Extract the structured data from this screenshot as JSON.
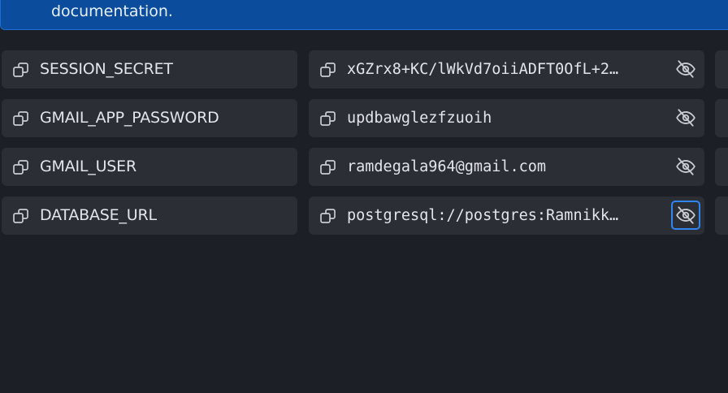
{
  "banner": {
    "text": "documentation."
  },
  "secrets": [
    {
      "key": "SESSION_SECRET",
      "value": "xGZrx8+KC/lWkVd7oiiADFT0OfL+2…",
      "eye_focused": false
    },
    {
      "key": "GMAIL_APP_PASSWORD",
      "value": "updbawglezfzuoih",
      "eye_focused": false
    },
    {
      "key": "GMAIL_USER",
      "value": "ramdegala964@gmail.com",
      "eye_focused": false
    },
    {
      "key": "DATABASE_URL",
      "value": "postgresql://postgres:Ramnikk…",
      "eye_focused": true
    }
  ],
  "icons": {
    "copy": "copy-icon",
    "hide": "eye-off-icon"
  },
  "colors": {
    "background": "#1c1f26",
    "cell": "#2b2e35",
    "banner": "#0b4d9c",
    "focus": "#2f86f3",
    "text": "#e3e5ea"
  }
}
